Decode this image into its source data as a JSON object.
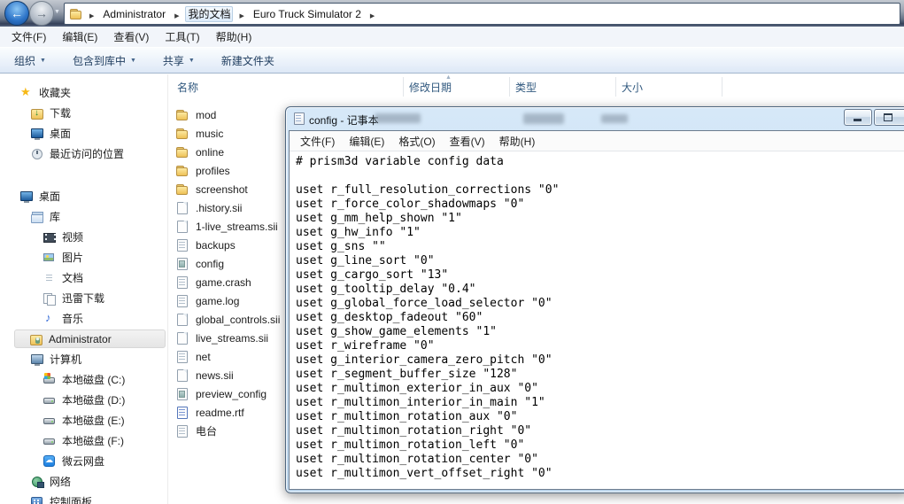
{
  "icons": {
    "back_arrow": "←",
    "forward_arrow": "→",
    "nav_chevron": "▼",
    "breadcrumb_arrow": "▶",
    "dropdown_arrow": "▼",
    "sort_ascending": "▲"
  },
  "explorer": {
    "breadcrumb": {
      "items": [
        {
          "label": "Administrator",
          "hover": false
        },
        {
          "label": "我的文档",
          "hover": true
        },
        {
          "label": "Euro Truck Simulator 2",
          "hover": false
        }
      ]
    },
    "menu": [
      "文件(F)",
      "编辑(E)",
      "查看(V)",
      "工具(T)",
      "帮助(H)"
    ],
    "toolbar": [
      {
        "label": "组织",
        "dropdown": true
      },
      {
        "label": "包含到库中",
        "dropdown": true
      },
      {
        "label": "共享",
        "dropdown": true
      },
      {
        "label": "新建文件夹",
        "dropdown": false
      }
    ],
    "columns": [
      "名称",
      "修改日期",
      "类型",
      "大小"
    ],
    "sidebar_favorites": [
      {
        "label": "收藏夹",
        "icon": "star",
        "level": 0,
        "selected": false
      },
      {
        "label": "下载",
        "icon": "download-folder",
        "level": 1,
        "selected": false
      },
      {
        "label": "桌面",
        "icon": "desktop-monitor",
        "level": 1,
        "selected": false
      },
      {
        "label": "最近访问的位置",
        "icon": "recent-places",
        "level": 1,
        "selected": false
      }
    ],
    "sidebar_tree": [
      {
        "label": "桌面",
        "icon": "desktop-monitor",
        "level": 0,
        "selected": false
      },
      {
        "label": "库",
        "icon": "library",
        "level": 1,
        "selected": false
      },
      {
        "label": "视频",
        "icon": "videos",
        "level": 2,
        "selected": false
      },
      {
        "label": "图片",
        "icon": "pictures",
        "level": 2,
        "selected": false
      },
      {
        "label": "文档",
        "icon": "text-file",
        "level": 2,
        "selected": false
      },
      {
        "label": "迅雷下载",
        "icon": "thunder-download",
        "level": 2,
        "selected": false
      },
      {
        "label": "音乐",
        "icon": "music",
        "level": 2,
        "selected": false
      },
      {
        "label": "Administrator",
        "icon": "user-folder",
        "level": 1,
        "selected": true
      },
      {
        "label": "计算机",
        "icon": "computer",
        "level": 1,
        "selected": false
      },
      {
        "label": "本地磁盘 (C:)",
        "icon": "drive-windows",
        "level": 2,
        "selected": false
      },
      {
        "label": "本地磁盘 (D:)",
        "icon": "drive",
        "level": 2,
        "selected": false
      },
      {
        "label": "本地磁盘 (E:)",
        "icon": "drive",
        "level": 2,
        "selected": false
      },
      {
        "label": "本地磁盘 (F:)",
        "icon": "drive",
        "level": 2,
        "selected": false
      },
      {
        "label": "微云网盘",
        "icon": "cloud-drive",
        "level": 2,
        "selected": false
      },
      {
        "label": "网络",
        "icon": "network",
        "level": 1,
        "selected": false
      },
      {
        "label": "控制面板",
        "icon": "control-panel",
        "level": 1,
        "selected": false
      }
    ],
    "files": [
      {
        "name": "mod",
        "icon": "folder"
      },
      {
        "name": "music",
        "icon": "folder"
      },
      {
        "name": "online",
        "icon": "folder"
      },
      {
        "name": "profiles",
        "icon": "folder"
      },
      {
        "name": "screenshot",
        "icon": "folder"
      },
      {
        "name": ".history.sii",
        "icon": "sii-file"
      },
      {
        "name": "1-live_streams.sii",
        "icon": "sii-file"
      },
      {
        "name": "backups",
        "icon": "text-file"
      },
      {
        "name": "config",
        "icon": "config-file"
      },
      {
        "name": "game.crash",
        "icon": "text-file"
      },
      {
        "name": "game.log",
        "icon": "text-file"
      },
      {
        "name": "global_controls.sii",
        "icon": "sii-file"
      },
      {
        "name": "live_streams.sii",
        "icon": "sii-file"
      },
      {
        "name": "net",
        "icon": "text-file"
      },
      {
        "name": "news.sii",
        "icon": "sii-file"
      },
      {
        "name": "preview_config",
        "icon": "config-file"
      },
      {
        "name": "readme.rtf",
        "icon": "rtf-file"
      },
      {
        "name": "电台",
        "icon": "text-file"
      }
    ]
  },
  "notepad": {
    "title": "config - 记事本",
    "menu": [
      "文件(F)",
      "编辑(E)",
      "格式(O)",
      "查看(V)",
      "帮助(H)"
    ],
    "lines": [
      "# prism3d variable config data",
      "",
      "uset r_full_resolution_corrections \"0\"",
      "uset r_force_color_shadowmaps \"0\"",
      "uset g_mm_help_shown \"1\"",
      "uset g_hw_info \"1\"",
      "uset g_sns \"\"",
      "uset g_line_sort \"0\"",
      "uset g_cargo_sort \"13\"",
      "uset g_tooltip_delay \"0.4\"",
      "uset g_global_force_load_selector \"0\"",
      "uset g_desktop_fadeout \"60\"",
      "uset g_show_game_elements \"1\"",
      "uset r_wireframe \"0\"",
      "uset g_interior_camera_zero_pitch \"0\"",
      "uset r_segment_buffer_size \"128\"",
      "uset r_multimon_exterior_in_aux \"0\"",
      "uset r_multimon_interior_in_main \"1\"",
      "uset r_multimon_rotation_aux \"0\"",
      "uset r_multimon_rotation_right \"0\"",
      "uset r_multimon_rotation_left \"0\"",
      "uset r_multimon_rotation_center \"0\"",
      "uset r_multimon_vert_offset_right \"0\""
    ]
  },
  "colors": {
    "titlebar_glass": "#c9def3",
    "toolbar_text": "#1e3c5e",
    "header_text": "#31597f",
    "folder_yellow": "#eec257"
  }
}
